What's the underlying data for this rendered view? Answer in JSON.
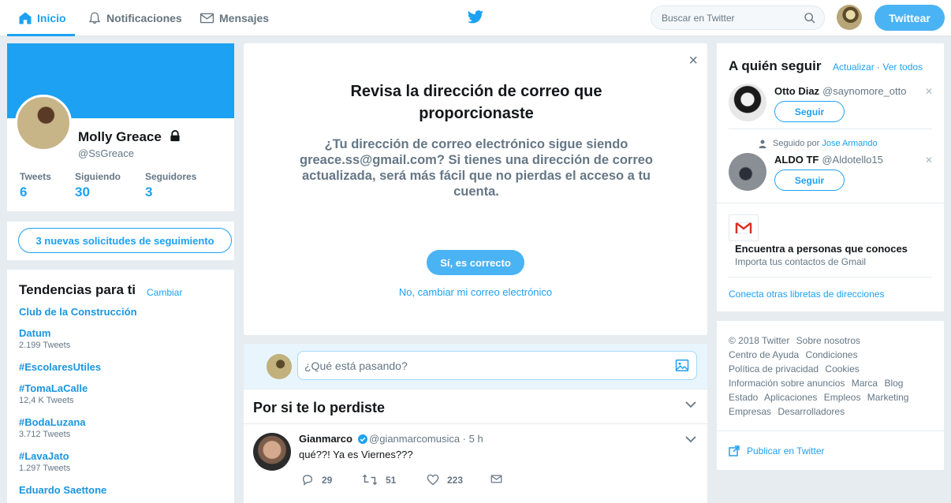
{
  "nav": {
    "home": "Inicio",
    "notifications": "Notificaciones",
    "messages": "Mensajes",
    "search_placeholder": "Buscar en Twitter",
    "tweet_button": "Twittear"
  },
  "profile": {
    "name": "Molly Greace",
    "handle": "@SsGreace",
    "stats": [
      {
        "label": "Tweets",
        "value": "6"
      },
      {
        "label": "Siguiendo",
        "value": "30"
      },
      {
        "label": "Seguidores",
        "value": "3"
      }
    ]
  },
  "requests": {
    "label": "3 nuevas solicitudes de seguimiento"
  },
  "trends": {
    "title": "Tendencias para ti",
    "change": "Cambiar",
    "items": [
      {
        "name": "Club de la Construcción",
        "count": ""
      },
      {
        "name": "Datum",
        "count": "2.199 Tweets"
      },
      {
        "name": "#EscolaresUtiles",
        "count": ""
      },
      {
        "name": "#TomaLaCalle",
        "count": "12,4 K Tweets"
      },
      {
        "name": "#BodaLuzana",
        "count": "3.712 Tweets"
      },
      {
        "name": "#LavaJato",
        "count": "1.297 Tweets"
      },
      {
        "name": "Eduardo Saettone",
        "count": ""
      }
    ]
  },
  "modal": {
    "close": "×",
    "title": "Revisa la dirección de correo que proporcionaste",
    "body": "¿Tu dirección de correo electrónico sigue siendo greace.ss@gmail.com? Si tienes una dirección de correo actualizada, será más fácil que no pierdas el acceso a tu cuenta.",
    "confirm": "Sí, es correcto",
    "change": "No, cambiar mi correo electrónico"
  },
  "compose": {
    "placeholder": "¿Qué está pasando?"
  },
  "feed": {
    "title": "Por si te lo perdiste",
    "tweet": {
      "name": "Gianmarco",
      "handle": "@gianmarcomusica · 5 h",
      "text": "qué??! Ya es Viernes???",
      "replies": "29",
      "retweets": "51",
      "likes": "223"
    }
  },
  "who_to_follow": {
    "title": "A quién seguir",
    "refresh": "Actualizar",
    "sep": "·",
    "view_all": "Ver todos",
    "follow_label": "Seguir",
    "suggestions": [
      {
        "name": "Otto Diaz",
        "handle": "@saynomore_otto",
        "context_prefix": "",
        "context_link": ""
      },
      {
        "name": "ALDO TF",
        "handle": "@Aldotello15",
        "context_prefix": "Seguido por",
        "context_link": "Jose Armando"
      }
    ],
    "find_title": "Encuentra a personas que conoces",
    "find_sub": "Importa tus contactos de Gmail",
    "connect": "Conecta otras libretas de direcciones"
  },
  "footer": {
    "lines": [
      [
        "© 2018 Twitter",
        "Sobre nosotros"
      ],
      [
        "Centro de Ayuda",
        "Condiciones"
      ],
      [
        "Política de privacidad",
        "Cookies"
      ],
      [
        "Información sobre anuncios",
        "Marca",
        "Blog"
      ],
      [
        "Estado",
        "Aplicaciones",
        "Empleos",
        "Marketing"
      ],
      [
        "Empresas",
        "Desarrolladores"
      ]
    ],
    "publish": "Publicar en Twitter"
  },
  "colors": {
    "accent": "#1da1f2",
    "button": "#4ab3f4",
    "page_bg": "#e6ecf0"
  }
}
